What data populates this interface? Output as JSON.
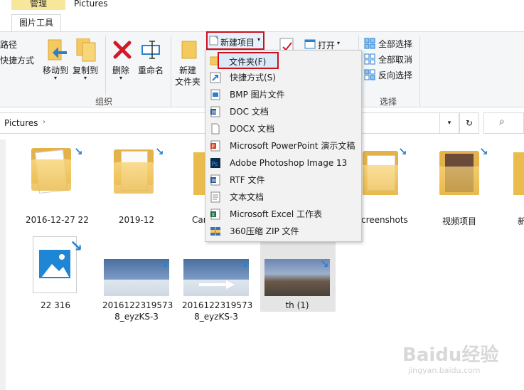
{
  "tabs": {
    "context_group": "管理",
    "context_tab": "图片工具",
    "window_title": "Pictures"
  },
  "ribbon": {
    "paste_path": "路径",
    "paste_shortcut": "快捷方式",
    "move_to": "移动到",
    "copy_to": "复制到",
    "delete": "删除",
    "rename": "重命名",
    "organize_label": "组织",
    "new_item": "新建项目",
    "new_folder_l1": "新建",
    "new_folder_l2": "文件夹",
    "open": "打开",
    "select_all": "全部选择",
    "select_none": "全部取消",
    "invert_selection": "反向选择",
    "select_label": "选择"
  },
  "address": {
    "path": "Pictures",
    "refresh_icon": "↻",
    "search_icon": "⌕"
  },
  "files": [
    {
      "name": "2016-12-27 22"
    },
    {
      "name": "2019-12"
    },
    {
      "name": "Car"
    },
    {
      "name": "creenshots"
    },
    {
      "name": "视频项目"
    },
    {
      "name": "新"
    },
    {
      "name": "22 316"
    },
    {
      "name_l1": "2016122319573",
      "name_l2": "8_eyzKS-3"
    },
    {
      "name_l1": "2016122319573",
      "name_l2": "8_eyzKS-3"
    },
    {
      "name": "th (1)"
    }
  ],
  "new_menu": [
    {
      "label": "文件夹(F)",
      "icon": "folder-icon"
    },
    {
      "label": "快捷方式(S)",
      "icon": "shortcut-icon"
    },
    {
      "label": "BMP 图片文件",
      "icon": "bmp-file-icon"
    },
    {
      "label": "DOC 文档",
      "icon": "doc-file-icon"
    },
    {
      "label": "DOCX 文档",
      "icon": "docx-file-icon"
    },
    {
      "label": "Microsoft PowerPoint 演示文稿",
      "icon": "powerpoint-icon"
    },
    {
      "label": "Adobe Photoshop Image 13",
      "icon": "photoshop-icon"
    },
    {
      "label": "RTF 文件",
      "icon": "rtf-file-icon"
    },
    {
      "label": "文本文档",
      "icon": "text-file-icon"
    },
    {
      "label": "Microsoft Excel 工作表",
      "icon": "excel-icon"
    },
    {
      "label": "360压缩 ZIP 文件",
      "icon": "zip-file-icon"
    }
  ],
  "watermark": {
    "brand": "Baidu经验",
    "url": "jingyan.baidu.com"
  },
  "colors": {
    "highlight_red": "#cc0f1c",
    "context_tab": "#f6e79a",
    "folder": "#eabb4d",
    "accent_blue": "#2a83d0"
  }
}
